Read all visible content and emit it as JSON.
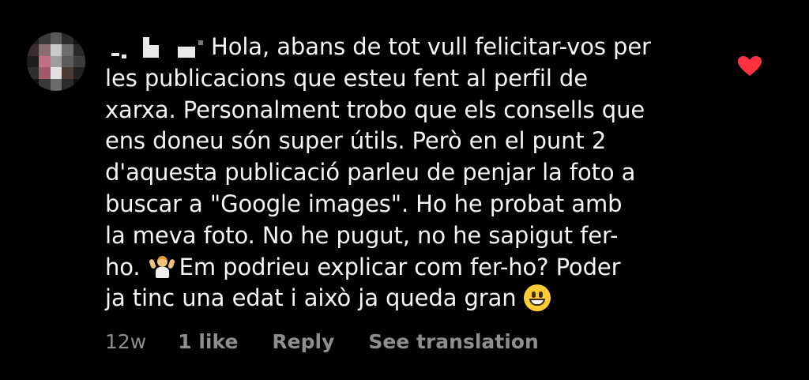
{
  "comment": {
    "username_redacted": true,
    "lines": [
      "Hola, abans de tot vull felicitar-vos per",
      "les publicacions que esteu fent al perfil de",
      "xarxa. Personalment trobo que els consells que",
      "ens doneu són super útils. Però en el punt 2",
      "d'aquesta publicació  parleu de penjar la foto a",
      "buscar a \"Google images\". Ho he probat amb",
      "la meva foto. No he pugut, no he sapigut fer-",
      "ho.",
      "Em podrieu explicar com fer-ho? Poder",
      "ja tinc una edat i això ja queda gran"
    ],
    "emojis": [
      "person-shrugging-icon",
      "grinning-face-icon"
    ],
    "liked": true,
    "like_color": "#ff3040"
  },
  "meta": {
    "time": "12w",
    "likes": "1 like",
    "reply": "Reply",
    "see_translation": "See translation"
  },
  "colors": {
    "background": "#000000",
    "text": "#f5f5f5",
    "muted": "#8e8e8e",
    "heart": "#ff3040"
  }
}
